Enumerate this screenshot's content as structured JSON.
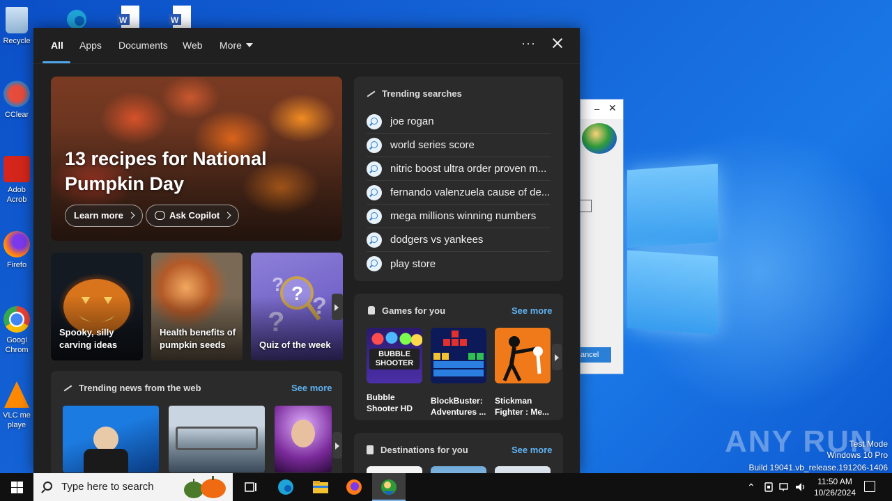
{
  "desktop": {
    "icons": [
      {
        "label": "Recycle"
      },
      {
        "label": "CClear"
      },
      {
        "label": "Adob Acrob"
      },
      {
        "label": "Firefo"
      },
      {
        "label": "Googl Chrom"
      },
      {
        "label": "VLC me playe"
      }
    ],
    "watermark": {
      "brand": "ANY RUN",
      "line1": "Test Mode",
      "line2": "Windows 10 Pro",
      "line3": "Build 19041.vb_release.191206-1406"
    }
  },
  "dialog": {
    "min_label": "–",
    "close_label": "✕",
    "cancel_label": "ancel"
  },
  "flyout": {
    "tabs": [
      {
        "label": "All"
      },
      {
        "label": "Apps"
      },
      {
        "label": "Documents"
      },
      {
        "label": "Web"
      },
      {
        "label": "More"
      }
    ],
    "menu_label": "···",
    "hero": {
      "title": "13 recipes for National Pumpkin Day",
      "learn_more": "Learn more",
      "ask_copilot": "Ask Copilot"
    },
    "tiles": [
      {
        "caption": "Spooky, silly carving ideas"
      },
      {
        "caption": "Health benefits of pumpkin seeds"
      },
      {
        "caption": "Quiz of the week"
      }
    ],
    "trending_searches": {
      "title": "Trending searches",
      "items": [
        "joe rogan",
        "world series score",
        "nitric boost ultra order proven m...",
        "fernando valenzuela cause of de...",
        "mega millions winning numbers",
        "dodgers vs yankees",
        "play store"
      ]
    },
    "games": {
      "title": "Games for you",
      "see_more": "See more",
      "items": [
        {
          "name": "Bubble Shooter HD",
          "logo_text": "BUBBLE SHOOTER"
        },
        {
          "name": "BlockBuster: Adventures ..."
        },
        {
          "name": "Stickman Fighter : Me..."
        }
      ]
    },
    "news": {
      "title": "Trending news from the web",
      "see_more": "See more"
    },
    "destinations": {
      "title": "Destinations for you",
      "see_more": "See more"
    }
  },
  "taskbar": {
    "search_placeholder": "Type here to search",
    "time": "11:50 AM",
    "date": "10/26/2024"
  },
  "colors": {
    "accent": "#5fb2f2",
    "flyout_bg": "#202020",
    "card_bg": "#2b2b2b"
  }
}
